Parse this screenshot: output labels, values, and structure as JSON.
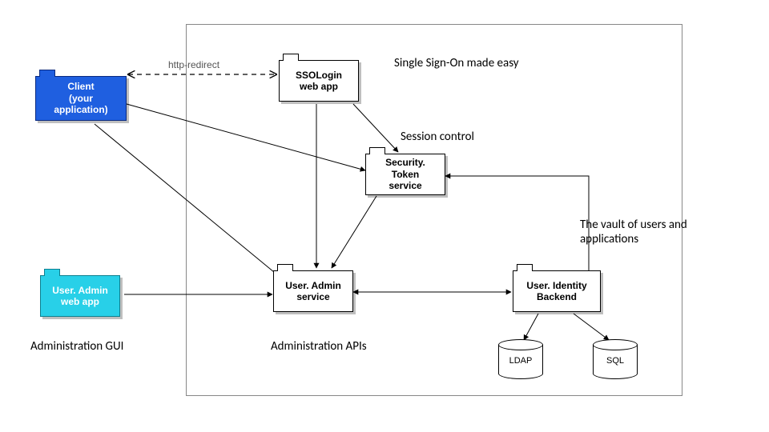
{
  "diagram": {
    "boundary_box": true,
    "nodes": {
      "client": {
        "label1": "Client",
        "label2": "(your application)"
      },
      "ssologin": {
        "label1": "SSOLogin",
        "label2": "web app"
      },
      "security": {
        "label1": "Security. Token",
        "label2": "service"
      },
      "useradminsvc": {
        "label1": "User. Admin",
        "label2": "service"
      },
      "identity": {
        "label1": "User. Identity",
        "label2": "Backend"
      },
      "useradminapp": {
        "label1": "User. Admin",
        "label2": "web app"
      },
      "ldap": {
        "label": "LDAP"
      },
      "sql": {
        "label": "SQL"
      }
    },
    "edges": {
      "client_ssologin": {
        "label": "http-redirect",
        "style": "dashed-bidirectional"
      }
    },
    "annotations": {
      "sso_easy": "Single Sign-On made easy",
      "session_ctrl": "Session control",
      "vault": "The vault of users and applications",
      "admin_gui": "Administration GUI",
      "admin_apis": "Administration APIs"
    }
  }
}
